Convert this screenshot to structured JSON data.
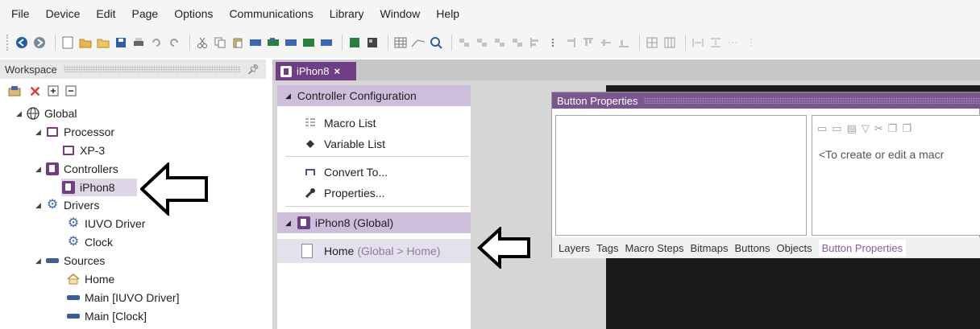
{
  "menu": [
    "File",
    "Device",
    "Edit",
    "Page",
    "Options",
    "Communications",
    "Library",
    "Window",
    "Help"
  ],
  "workspace": {
    "title": "Workspace",
    "tree": {
      "global": "Global",
      "processor": "Processor",
      "xp3": "XP-3",
      "controllers": "Controllers",
      "iphon8": "iPhon8",
      "drivers": "Drivers",
      "iuvo_driver": "IUVO Driver",
      "clock": "Clock",
      "sources": "Sources",
      "home": "Home",
      "main_iuvo": "Main [IUVO Driver]",
      "main_clock": "Main [Clock]"
    }
  },
  "editor_tab": {
    "label": "iPhon8",
    "close": "×"
  },
  "controller_panel": {
    "section1": "Controller Configuration",
    "macro_list": "Macro List",
    "variable_list": "Variable List",
    "convert_to": "Convert To...",
    "properties": "Properties...",
    "section2": "iPhon8 (Global)",
    "home": "Home",
    "home_path": "(Global > Home)"
  },
  "button_properties": {
    "title": "Button Properties",
    "hint": "<To create or edit a macr",
    "tabs": [
      "Layers",
      "Tags",
      "Macro Steps",
      "Bitmaps",
      "Buttons",
      "Objects",
      "Button Properties"
    ]
  },
  "colors": {
    "accent": "#6f3f86",
    "section_bg": "#cdbfdc",
    "canvas": "#1a1a1a"
  }
}
